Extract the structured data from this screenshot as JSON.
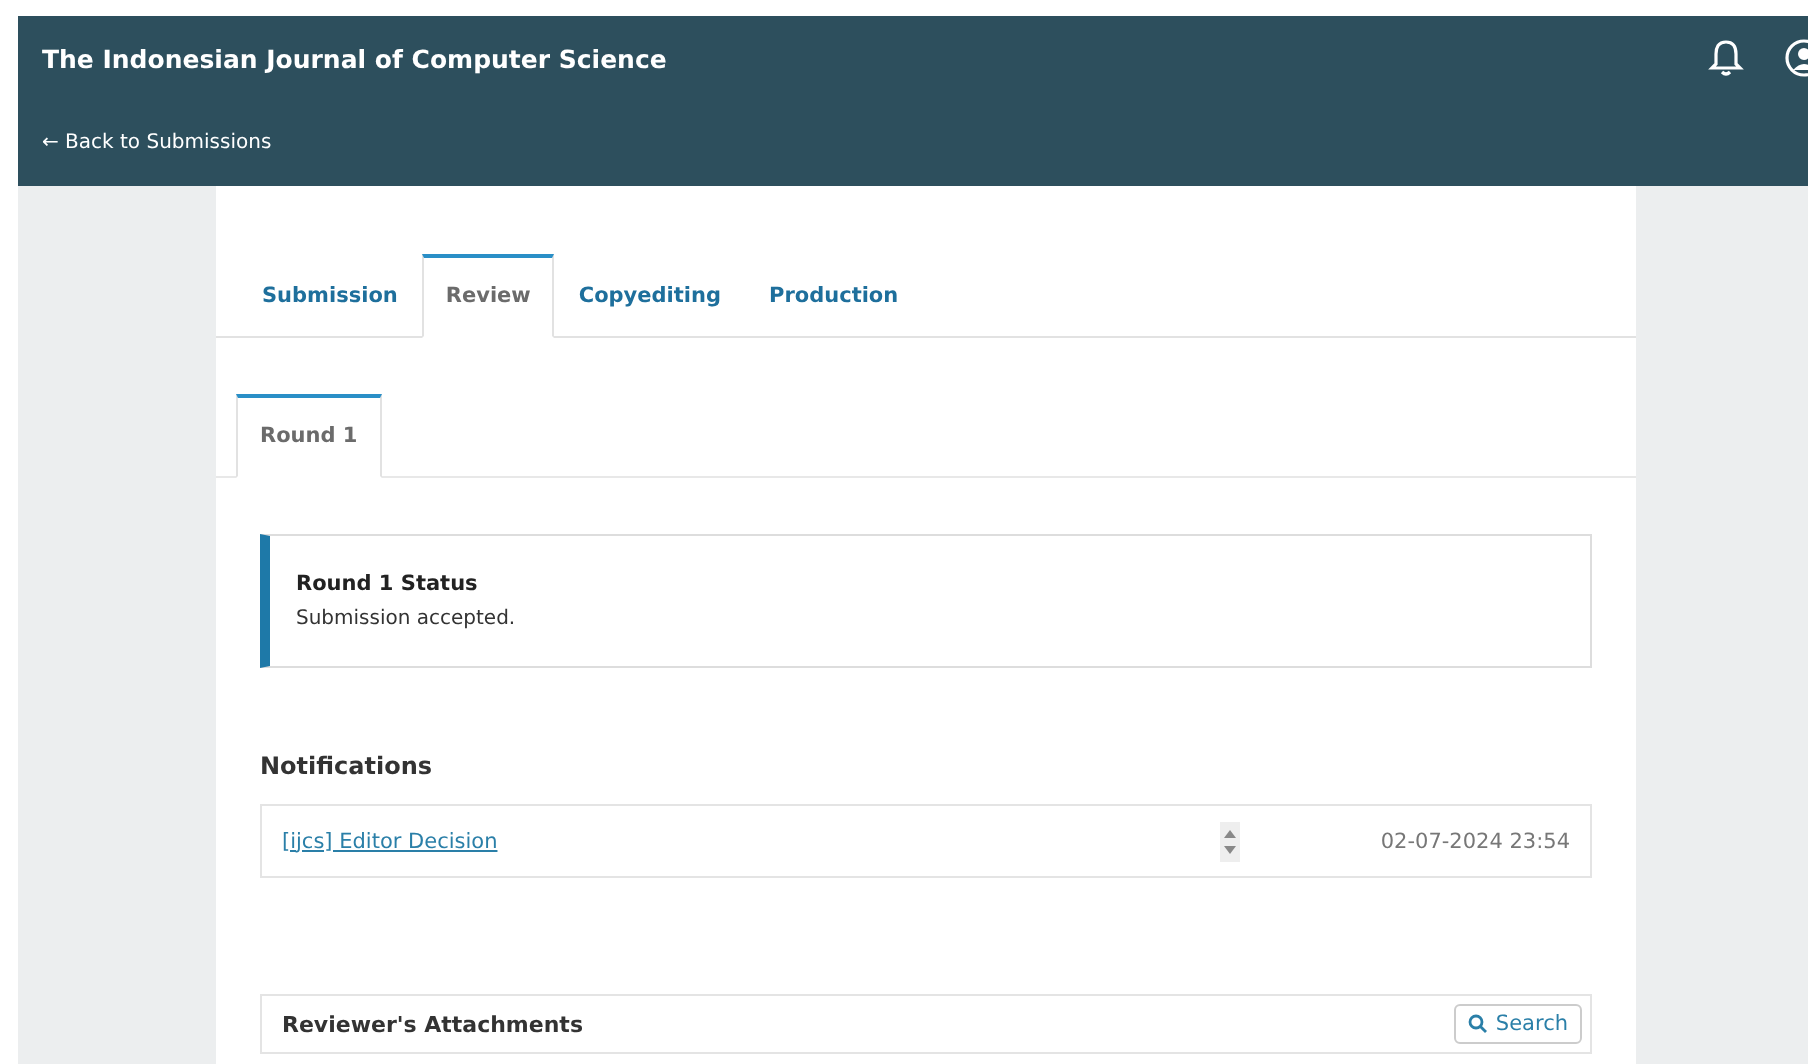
{
  "header": {
    "title": "The Indonesian Journal of Computer Science",
    "back_link": "← Back to Submissions"
  },
  "tabs": [
    {
      "label": "Submission",
      "selected": false
    },
    {
      "label": "Review",
      "selected": true
    },
    {
      "label": "Copyediting",
      "selected": false
    },
    {
      "label": "Production",
      "selected": false
    }
  ],
  "round_tabs": [
    {
      "label": "Round 1",
      "selected": true
    }
  ],
  "status": {
    "title": "Round 1 Status",
    "text": "Submission accepted."
  },
  "notifications": {
    "heading": "Notifications",
    "items": [
      {
        "subject": "[ijcs] Editor Decision",
        "date": "02-07-2024 23:54"
      }
    ]
  },
  "attachments": {
    "title": "Reviewer's Attachments",
    "search_button": "Search"
  }
}
